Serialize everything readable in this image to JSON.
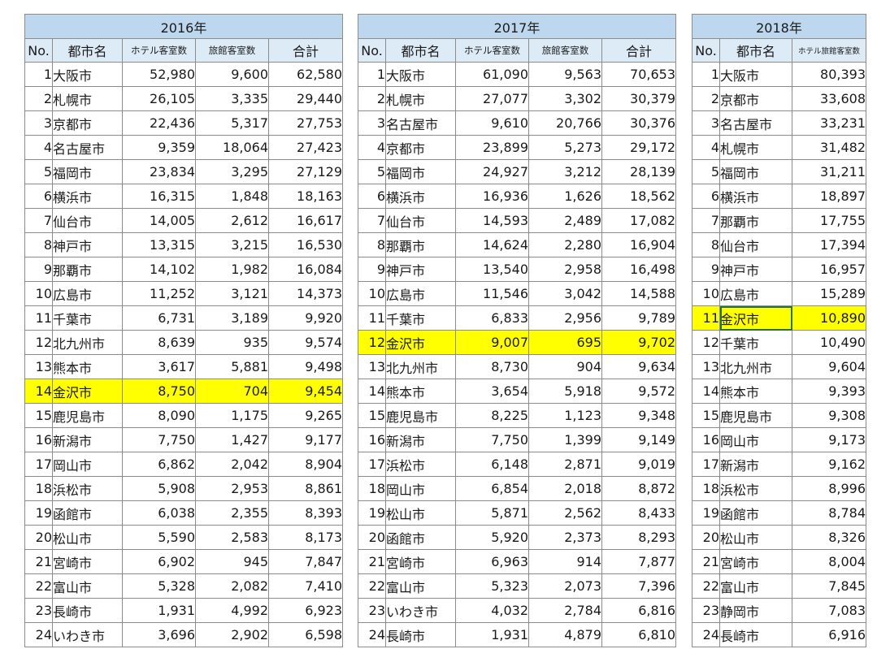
{
  "tables": [
    {
      "year": "2016年",
      "headers": [
        "No.",
        "都市名",
        "ホテル客室数",
        "旅館客室数",
        "合計"
      ],
      "rows": [
        [
          "1",
          "大阪市",
          "52,980",
          "9,600",
          "62,580"
        ],
        [
          "2",
          "札幌市",
          "26,105",
          "3,335",
          "29,440"
        ],
        [
          "3",
          "京都市",
          "22,436",
          "5,317",
          "27,753"
        ],
        [
          "4",
          "名古屋市",
          "9,359",
          "18,064",
          "27,423"
        ],
        [
          "5",
          "福岡市",
          "23,834",
          "3,295",
          "27,129"
        ],
        [
          "6",
          "横浜市",
          "16,315",
          "1,848",
          "18,163"
        ],
        [
          "7",
          "仙台市",
          "14,005",
          "2,612",
          "16,617"
        ],
        [
          "8",
          "神戸市",
          "13,315",
          "3,215",
          "16,530"
        ],
        [
          "9",
          "那覇市",
          "14,102",
          "1,982",
          "16,084"
        ],
        [
          "10",
          "広島市",
          "11,252",
          "3,121",
          "14,373"
        ],
        [
          "11",
          "千葉市",
          "6,731",
          "3,189",
          "9,920"
        ],
        [
          "12",
          "北九州市",
          "8,639",
          "935",
          "9,574"
        ],
        [
          "13",
          "熊本市",
          "3,617",
          "5,881",
          "9,498"
        ],
        [
          "14",
          "金沢市",
          "8,750",
          "704",
          "9,454"
        ],
        [
          "15",
          "鹿児島市",
          "8,090",
          "1,175",
          "9,265"
        ],
        [
          "16",
          "新潟市",
          "7,750",
          "1,427",
          "9,177"
        ],
        [
          "17",
          "岡山市",
          "6,862",
          "2,042",
          "8,904"
        ],
        [
          "18",
          "浜松市",
          "5,908",
          "2,953",
          "8,861"
        ],
        [
          "19",
          "函館市",
          "6,038",
          "2,355",
          "8,393"
        ],
        [
          "20",
          "松山市",
          "5,590",
          "2,583",
          "8,173"
        ],
        [
          "21",
          "宮崎市",
          "6,902",
          "945",
          "7,847"
        ],
        [
          "22",
          "富山市",
          "5,328",
          "2,082",
          "7,410"
        ],
        [
          "23",
          "長崎市",
          "1,931",
          "4,992",
          "6,923"
        ],
        [
          "24",
          "いわき市",
          "3,696",
          "2,902",
          "6,598"
        ]
      ]
    },
    {
      "year": "2017年",
      "headers": [
        "No.",
        "都市名",
        "ホテル客室数",
        "旅館客室数",
        "合計"
      ],
      "rows": [
        [
          "1",
          "大阪市",
          "61,090",
          "9,563",
          "70,653"
        ],
        [
          "2",
          "札幌市",
          "27,077",
          "3,302",
          "30,379"
        ],
        [
          "3",
          "名古屋市",
          "9,610",
          "20,766",
          "30,376"
        ],
        [
          "4",
          "京都市",
          "23,899",
          "5,273",
          "29,172"
        ],
        [
          "5",
          "福岡市",
          "24,927",
          "3,212",
          "28,139"
        ],
        [
          "6",
          "横浜市",
          "16,936",
          "1,626",
          "18,562"
        ],
        [
          "7",
          "仙台市",
          "14,593",
          "2,489",
          "17,082"
        ],
        [
          "8",
          "那覇市",
          "14,624",
          "2,280",
          "16,904"
        ],
        [
          "9",
          "神戸市",
          "13,540",
          "2,958",
          "16,498"
        ],
        [
          "10",
          "広島市",
          "11,546",
          "3,042",
          "14,588"
        ],
        [
          "11",
          "千葉市",
          "6,833",
          "2,956",
          "9,789"
        ],
        [
          "12",
          "金沢市",
          "9,007",
          "695",
          "9,702"
        ],
        [
          "13",
          "北九州市",
          "8,730",
          "904",
          "9,634"
        ],
        [
          "14",
          "熊本市",
          "3,654",
          "5,918",
          "9,572"
        ],
        [
          "15",
          "鹿児島市",
          "8,225",
          "1,123",
          "9,348"
        ],
        [
          "16",
          "新潟市",
          "7,750",
          "1,399",
          "9,149"
        ],
        [
          "17",
          "浜松市",
          "6,148",
          "2,871",
          "9,019"
        ],
        [
          "18",
          "岡山市",
          "6,854",
          "2,018",
          "8,872"
        ],
        [
          "19",
          "松山市",
          "5,871",
          "2,562",
          "8,433"
        ],
        [
          "20",
          "函館市",
          "5,920",
          "2,373",
          "8,293"
        ],
        [
          "21",
          "宮崎市",
          "6,963",
          "914",
          "7,877"
        ],
        [
          "22",
          "富山市",
          "5,323",
          "2,073",
          "7,396"
        ],
        [
          "23",
          "いわき市",
          "4,032",
          "2,784",
          "6,816"
        ],
        [
          "24",
          "長崎市",
          "1,931",
          "4,879",
          "6,810"
        ]
      ]
    },
    {
      "year": "2018年",
      "headers": [
        "No.",
        "都市名",
        "ホテル旅館客室数"
      ],
      "rows": [
        [
          "1",
          "大阪市",
          "80,393"
        ],
        [
          "2",
          "京都市",
          "33,608"
        ],
        [
          "3",
          "名古屋市",
          "33,231"
        ],
        [
          "4",
          "札幌市",
          "31,482"
        ],
        [
          "5",
          "福岡市",
          "31,211"
        ],
        [
          "6",
          "横浜市",
          "18,897"
        ],
        [
          "7",
          "那覇市",
          "17,755"
        ],
        [
          "8",
          "仙台市",
          "17,394"
        ],
        [
          "9",
          "神戸市",
          "16,957"
        ],
        [
          "10",
          "広島市",
          "15,289"
        ],
        [
          "11",
          "金沢市",
          "10,890"
        ],
        [
          "12",
          "千葉市",
          "10,490"
        ],
        [
          "13",
          "北九州市",
          "9,604"
        ],
        [
          "14",
          "熊本市",
          "9,393"
        ],
        [
          "15",
          "鹿児島市",
          "9,308"
        ],
        [
          "16",
          "岡山市",
          "9,173"
        ],
        [
          "17",
          "新潟市",
          "9,162"
        ],
        [
          "18",
          "浜松市",
          "8,996"
        ],
        [
          "19",
          "函館市",
          "8,784"
        ],
        [
          "20",
          "松山市",
          "8,326"
        ],
        [
          "21",
          "宮崎市",
          "8,004"
        ],
        [
          "22",
          "富山市",
          "7,845"
        ],
        [
          "23",
          "静岡市",
          "7,083"
        ],
        [
          "24",
          "長崎市",
          "6,916"
        ]
      ]
    }
  ]
}
